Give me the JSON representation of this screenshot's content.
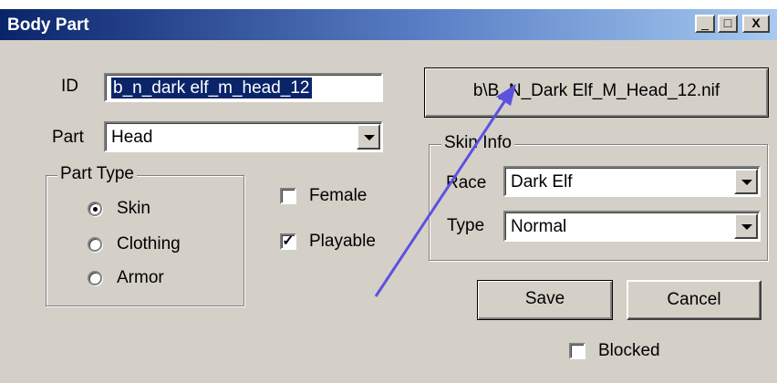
{
  "window": {
    "title": "Body Part",
    "controls": {
      "minimize": "_",
      "maximize": "□",
      "close": "X"
    }
  },
  "form": {
    "id_label": "ID",
    "id_value": "b_n_dark elf_m_head_12",
    "part_label": "Part",
    "part_value": "Head",
    "part_type": {
      "title": "Part Type",
      "options": [
        "Skin",
        "Clothing",
        "Armor"
      ],
      "selected": "Skin"
    },
    "female_label": "Female",
    "female_checked": false,
    "playable_label": "Playable",
    "playable_checked": true,
    "mesh_button_label": "b\\B_N_Dark Elf_M_Head_12.nif",
    "skin_info": {
      "title": "Skin Info",
      "race_label": "Race",
      "race_value": "Dark Elf",
      "type_label": "Type",
      "type_value": "Normal"
    },
    "save_label": "Save",
    "cancel_label": "Cancel",
    "blocked_label": "Blocked",
    "blocked_checked": false
  },
  "colors": {
    "title_gradient_start": "#0a246a",
    "title_gradient_end": "#a6caf0",
    "dialog_face": "#d4d0c8",
    "annotation_arrow": "#5b52e0"
  }
}
